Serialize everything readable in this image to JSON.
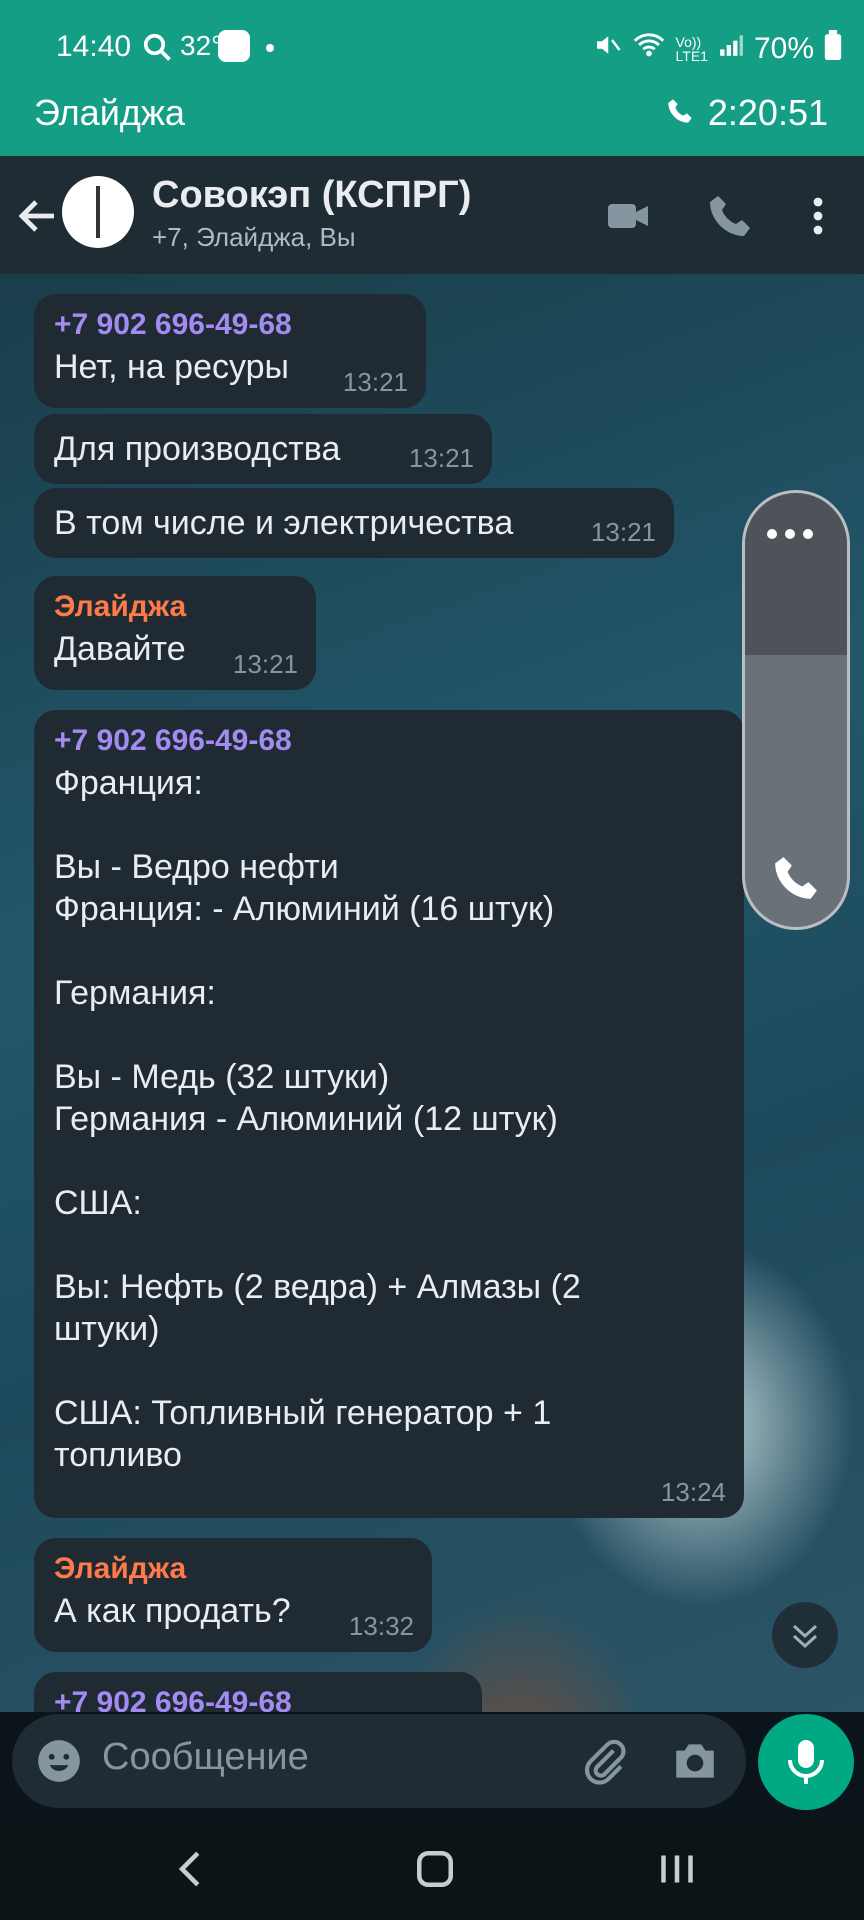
{
  "status_bar": {
    "time": "14:40",
    "temperature": "32°",
    "battery": "70%",
    "icons": [
      "search-icon",
      "discord-icon",
      "mute-icon",
      "wifi-icon",
      "volte-icon",
      "signal-icon",
      "battery-icon"
    ]
  },
  "call_banner": {
    "name": "Элайджа",
    "duration": "2:20:51"
  },
  "header": {
    "title": "Совокэп (КСПРГ)",
    "subtitle": "+7, Элайджа, Вы"
  },
  "messages": [
    {
      "sender": "+7 902 696-49-68",
      "text": "Нет, на ресуры",
      "time": "13:21"
    },
    {
      "sender": "",
      "text": "Для производства",
      "time": "13:21"
    },
    {
      "sender": "",
      "text": "В том числе и электричества",
      "time": "13:21"
    },
    {
      "sender": "Элайджа",
      "text": "Давайте",
      "time": "13:21"
    },
    {
      "sender": "+7 902 696-49-68",
      "text": "Франция:\n\nВы - Ведро нефти\nФранция: - Алюминий (16 штук)\n\nГермания:\n\nВы - Медь (32 штуки)\nГермания - Алюминий (12 штук)\n\nСША:\n\nВы: Нефть (2 ведра) + Алмазы (2\nштуки)\n\nСША: Топливный генератор + 1\nтопливо",
      "time": "13:24"
    },
    {
      "sender": "Элайджа",
      "text": "А как продать?",
      "time": "13:32"
    },
    {
      "sender": "+7 902 696-49-68",
      "text": "",
      "time": ""
    }
  ],
  "input": {
    "placeholder": "Сообщение"
  },
  "colors": {
    "accent": "#149e86",
    "mic": "#00a884",
    "sender_number": "#a48bf2",
    "sender_elijah": "#ff7a4a"
  }
}
